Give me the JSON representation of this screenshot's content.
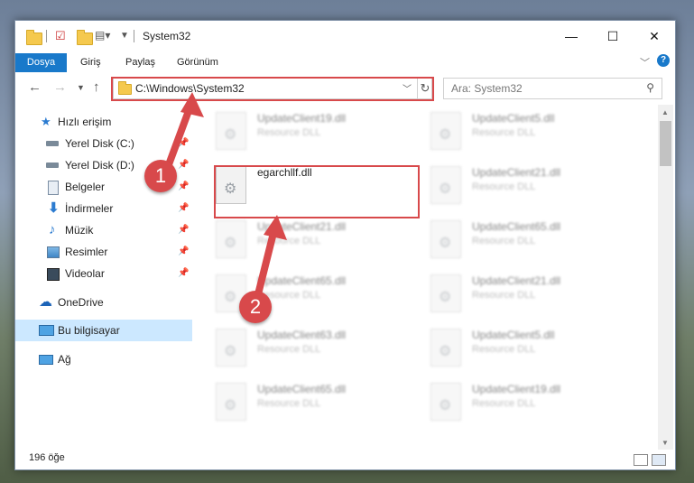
{
  "window": {
    "title": "System32",
    "minimize_icon": "—",
    "maximize_icon": "☐",
    "close_icon": "✕"
  },
  "ribbon": {
    "tabs": [
      "Dosya",
      "Giriş",
      "Paylaş",
      "Görünüm"
    ],
    "help": "?"
  },
  "nav": {
    "address": "C:\\Windows\\System32",
    "search_placeholder": "Ara: System32"
  },
  "sidebar": {
    "quick_access": "Hızlı erişim",
    "items": [
      "Yerel Disk (C:)",
      "Yerel Disk (D:)",
      "Belgeler",
      "İndirmeler",
      "Müzik",
      "Resimler",
      "Videolar"
    ],
    "onedrive": "OneDrive",
    "this_pc": "Bu bilgisayar",
    "network": "Ağ"
  },
  "files": {
    "highlighted": {
      "name": "egarchllf.dll"
    },
    "blurred": [
      {
        "name": "UpdateClient19.dll",
        "type": "Resource DLL"
      },
      {
        "name": "UpdateClient5.dll",
        "type": "Resource DLL"
      },
      {
        "name": "UpdateClient21.dll",
        "type": "Resource DLL"
      },
      {
        "name": "UpdateClient21.dll",
        "type": "Resource DLL"
      },
      {
        "name": "UpdateClient65.dll",
        "type": "Resource DLL"
      },
      {
        "name": "UpdateClient65.dll",
        "type": "Resource DLL"
      },
      {
        "name": "UpdateClient21.dll",
        "type": "Resource DLL"
      },
      {
        "name": "UpdateClient63.dll",
        "type": "Resource DLL"
      },
      {
        "name": "UpdateClient5.dll",
        "type": "Resource DLL"
      },
      {
        "name": "UpdateClient65.dll",
        "type": "Resource DLL"
      },
      {
        "name": "UpdateClient19.dll",
        "type": "Resource DLL"
      }
    ]
  },
  "status": {
    "count": "196 öğe"
  },
  "annotations": {
    "step1": "1",
    "step2": "2",
    "color": "#d8494b"
  }
}
